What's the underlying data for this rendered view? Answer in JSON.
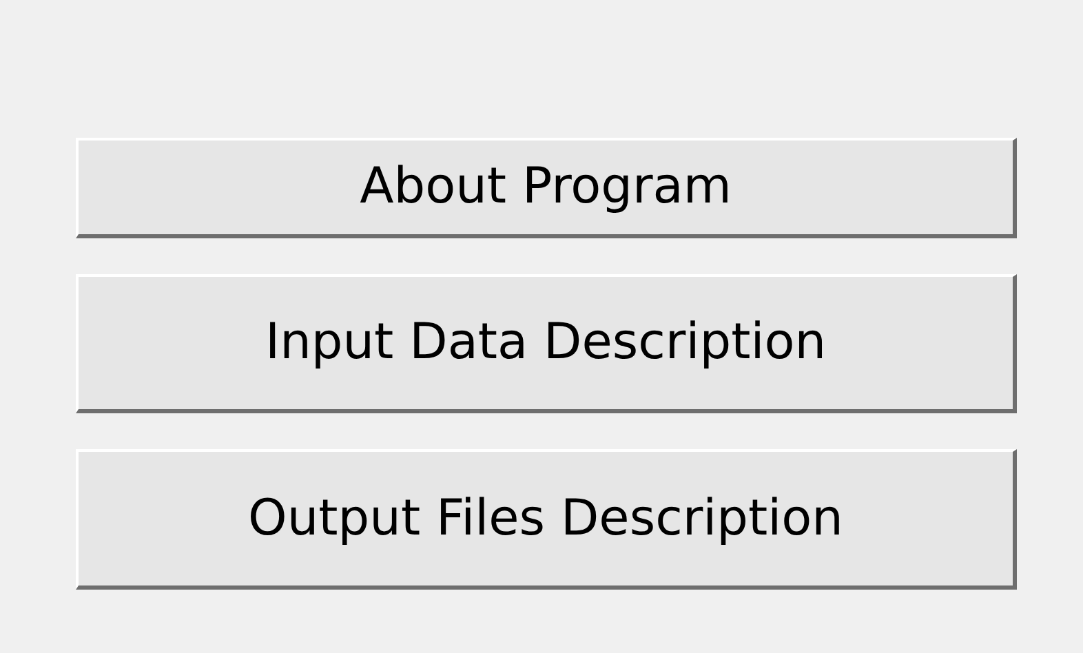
{
  "buttons": [
    {
      "label": "About Program"
    },
    {
      "label": "Input Data Description"
    },
    {
      "label": "Output Files Description"
    }
  ]
}
